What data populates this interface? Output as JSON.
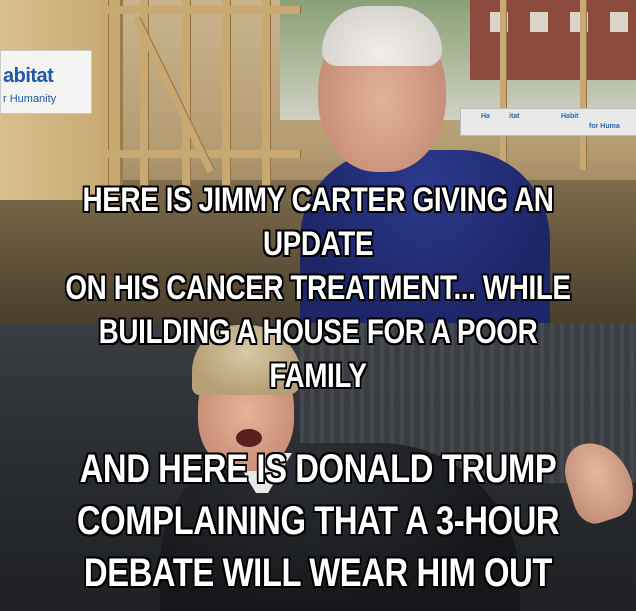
{
  "top_panel": {
    "sign_name": "abitat",
    "sign_sub": "r Humanity",
    "banner_segments": [
      "Ha",
      "itat",
      "Habit",
      "for Huma"
    ],
    "caption_lines": [
      "HERE IS JIMMY CARTER GIVING AN UPDATE",
      "ON HIS CANCER TREATMENT... WHILE",
      "BUILDING A HOUSE FOR A POOR FAMILY"
    ]
  },
  "bottom_panel": {
    "caption_lines": [
      "AND HERE IS DONALD TRUMP",
      "COMPLAINING THAT A 3-HOUR",
      "DEBATE WILL WEAR HIM OUT"
    ]
  },
  "colors": {
    "caption_text": "#ffffff",
    "caption_outline": "#000000",
    "habitat_blue": "#1f5aa6",
    "carter_shirt": "#1d2668"
  }
}
